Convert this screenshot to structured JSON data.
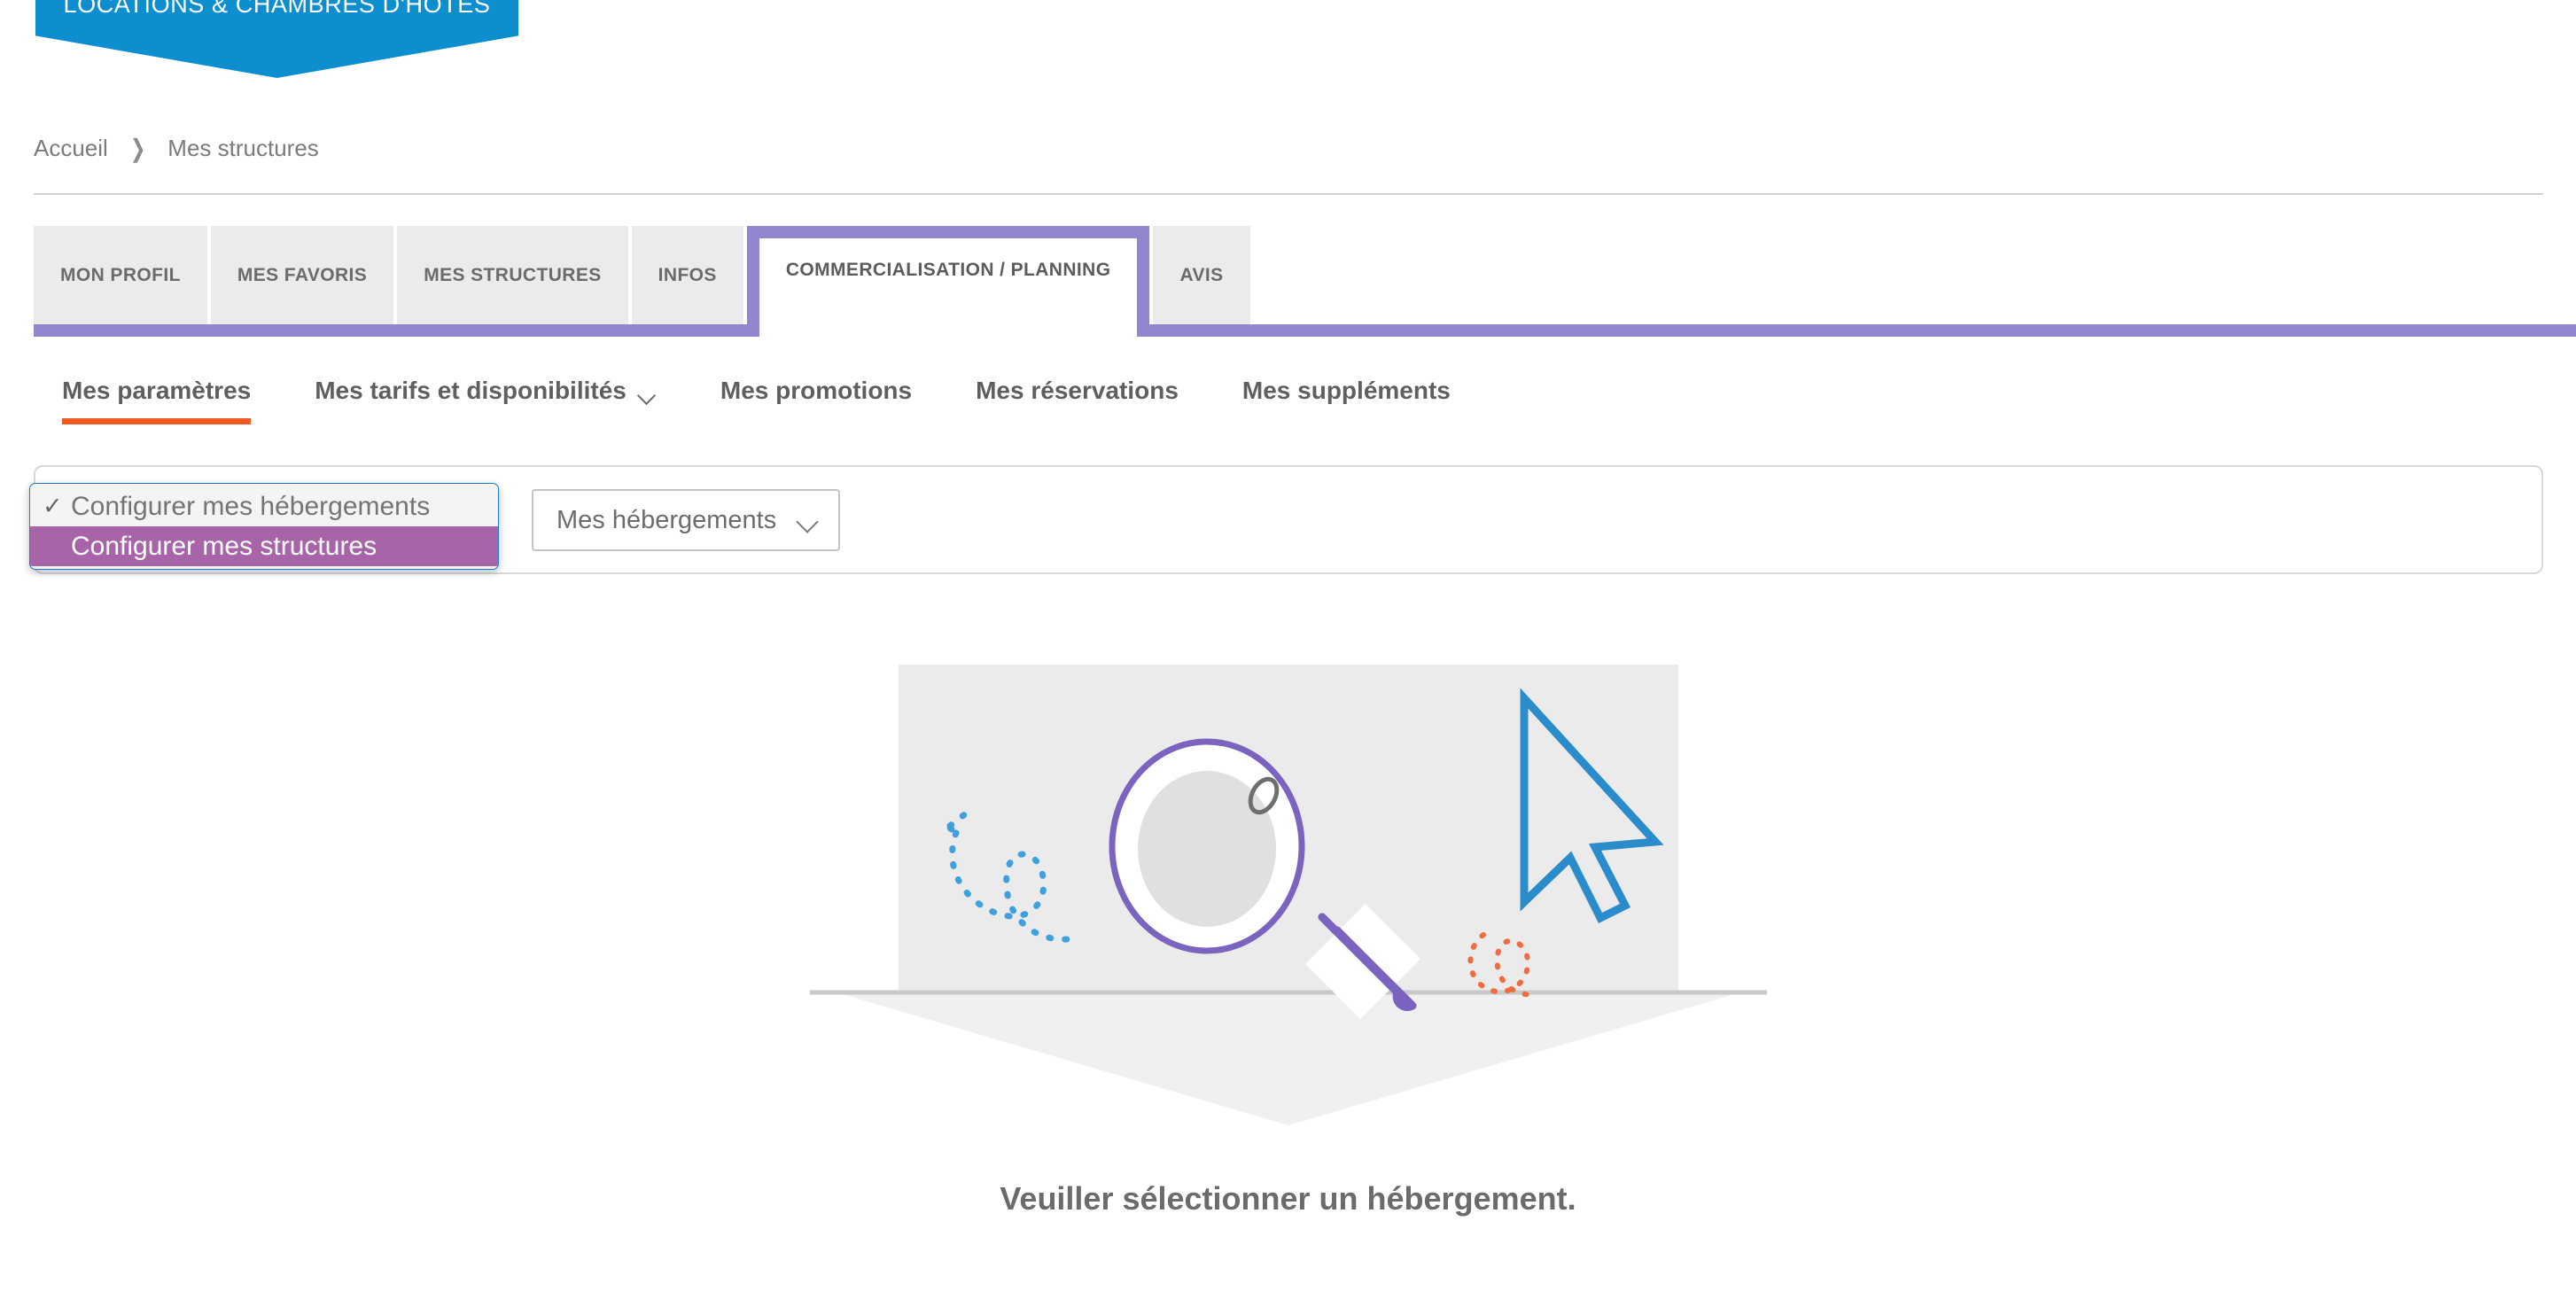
{
  "banner": {
    "title": "LOCATIONS & CHAMBRES D'HÔTES",
    "color": "#0d8ecf"
  },
  "breadcrumb": {
    "items": [
      {
        "label": "Accueil"
      },
      {
        "label": "Mes structures"
      }
    ],
    "separator": "›"
  },
  "main_tabs": {
    "active_index": 4,
    "accent_color": "#9187ce",
    "items": [
      {
        "label": "MON PROFIL"
      },
      {
        "label": "MES FAVORIS"
      },
      {
        "label": "MES STRUCTURES"
      },
      {
        "label": "INFOS"
      },
      {
        "label": "COMMERCIALISATION / PLANNING"
      },
      {
        "label": "AVIS"
      }
    ]
  },
  "subnav": {
    "active_index": 0,
    "active_color": "#f15a22",
    "items": [
      {
        "label": "Mes paramètres",
        "has_chevron": false
      },
      {
        "label": "Mes tarifs et disponibilités",
        "has_chevron": true
      },
      {
        "label": "Mes promotions",
        "has_chevron": false
      },
      {
        "label": "Mes réservations",
        "has_chevron": false
      },
      {
        "label": "Mes suppléments",
        "has_chevron": false
      }
    ]
  },
  "config_dropdown": {
    "open": true,
    "checkmark": "✓",
    "selected_index": 1,
    "highlight_color": "#a764a9",
    "options": [
      {
        "label": "Configurer mes hébergements",
        "checked": true
      },
      {
        "label": "Configurer mes structures",
        "checked": false
      }
    ]
  },
  "lodging_select": {
    "value": "Mes hébergements",
    "placeholder": "Mes hébergements",
    "chevron": "chevron-down-icon"
  },
  "empty_state": {
    "message": "Veuiller sélectionner un hébergement.",
    "illustration": {
      "name": "magnifier-search-illustration",
      "backdrop_color": "#ebebeb",
      "magnifier_color": "#7b63c0",
      "cursor_color": "#2b8ccc",
      "squiggle_blue": "#3fa0dd",
      "squiggle_orange": "#ee6c3f"
    }
  }
}
